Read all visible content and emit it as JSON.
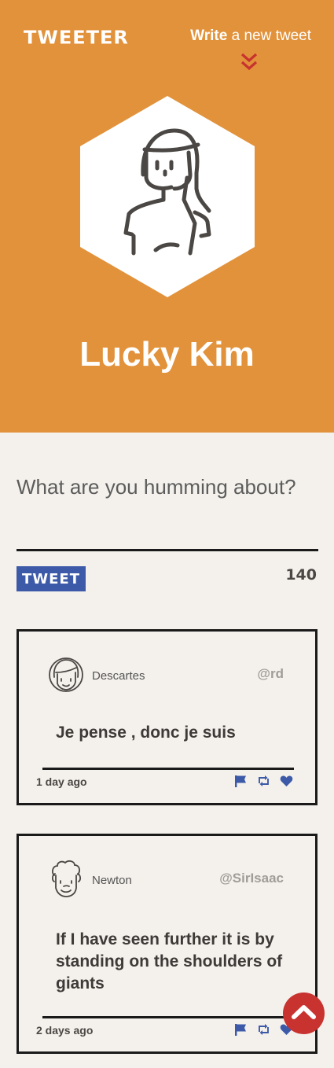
{
  "header": {
    "logo": "TWEETER",
    "write_bold": "Write",
    "write_rest": " a new tweet",
    "profile_name": "Lucky Kim"
  },
  "compose": {
    "placeholder": "What are you humming about?",
    "button_label": "TWEET",
    "char_count": "140"
  },
  "tweets": [
    {
      "author": "Descartes",
      "handle": "@rd",
      "text": "Je pense , donc je suis",
      "date": "1 day ago"
    },
    {
      "author": "Newton",
      "handle": "@SirIsaac",
      "text": "If I have seen further it is by standing on the shoulders of giants",
      "date": "2 days ago"
    }
  ],
  "colors": {
    "header_bg": "#e2923b",
    "accent_blue": "#3d5aa8",
    "accent_red": "#c8322f",
    "page_bg": "#f4f1ec"
  },
  "icons": [
    "chevron-double-down-icon",
    "flag-icon",
    "retweet-icon",
    "heart-icon",
    "chevron-up-icon"
  ]
}
